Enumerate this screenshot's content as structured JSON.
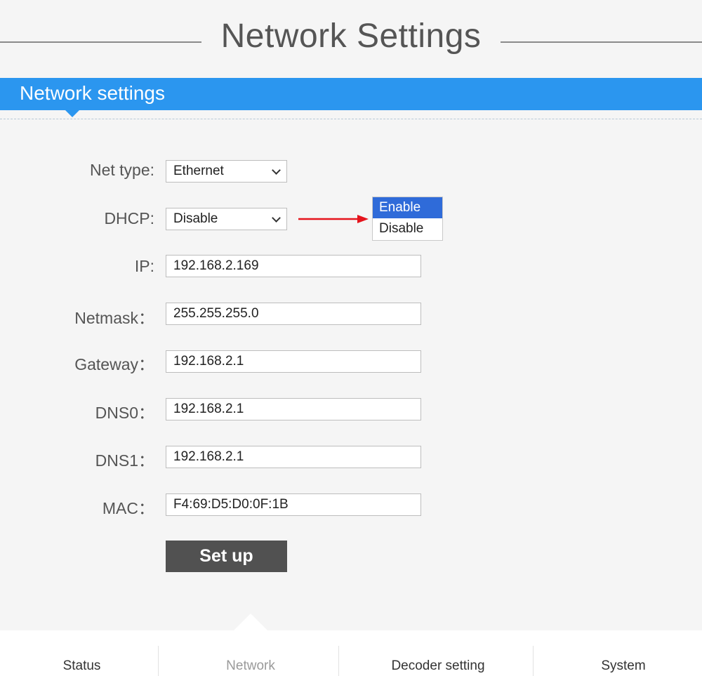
{
  "header": {
    "title": "Network Settings"
  },
  "section": {
    "title": "Network settings"
  },
  "form": {
    "net_type": {
      "label": "Net type:",
      "value": "Ethernet"
    },
    "dhcp": {
      "label": "DHCP:",
      "value": "Disable",
      "options": [
        "Enable",
        "Disable"
      ],
      "highlighted": "Enable"
    },
    "ip": {
      "label": "IP:",
      "value": "192.168.2.169"
    },
    "netmask": {
      "label": "Netmask：",
      "value": "255.255.255.0"
    },
    "gateway": {
      "label": "Gateway：",
      "value": "192.168.2.1"
    },
    "dns0": {
      "label": "DNS0：",
      "value": "192.168.2.1"
    },
    "dns1": {
      "label": "DNS1：",
      "value": "192.168.2.1"
    },
    "mac": {
      "label": "MAC：",
      "value": "F4:69:D5:D0:0F:1B"
    },
    "submit_label": "Set up"
  },
  "nav": {
    "items": [
      {
        "label": "Status"
      },
      {
        "label": "Network"
      },
      {
        "label": "Decoder setting"
      },
      {
        "label": "System"
      }
    ],
    "active": "Network"
  },
  "colors": {
    "banner": "#2b96ef",
    "option_highlight": "#2f6bd9",
    "button": "#515151",
    "arrow": "#e5141c"
  }
}
